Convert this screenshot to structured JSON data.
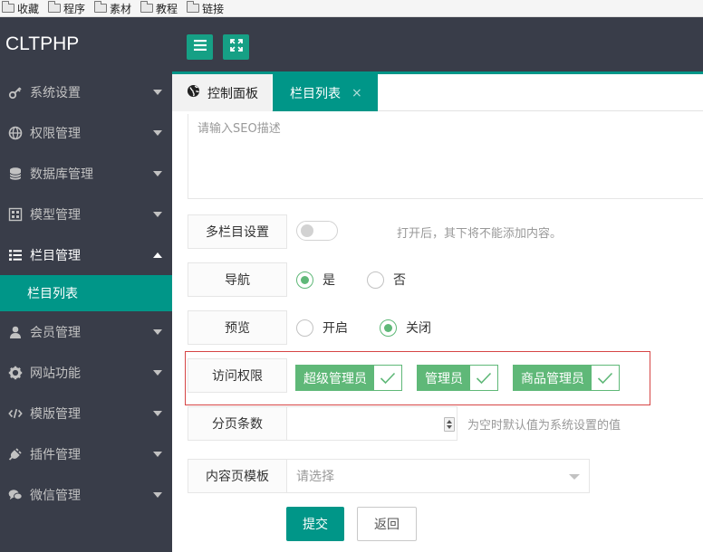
{
  "bookmarks": [
    {
      "label": "收藏"
    },
    {
      "label": "程序"
    },
    {
      "label": "素材"
    },
    {
      "label": "教程"
    },
    {
      "label": "链接"
    }
  ],
  "app": {
    "logo": "CLTPHP"
  },
  "sidebar": {
    "items": [
      {
        "label": "系统设置",
        "icon": "gear-key-icon"
      },
      {
        "label": "权限管理",
        "icon": "globe-icon"
      },
      {
        "label": "数据库管理",
        "icon": "database-icon"
      },
      {
        "label": "模型管理",
        "icon": "grid-icon"
      },
      {
        "label": "栏目管理",
        "icon": "list-icon"
      },
      {
        "label": "会员管理",
        "icon": "user-icon"
      },
      {
        "label": "网站功能",
        "icon": "gear-icon"
      },
      {
        "label": "模版管理",
        "icon": "code-icon"
      },
      {
        "label": "插件管理",
        "icon": "plug-icon"
      },
      {
        "label": "微信管理",
        "icon": "chat-icon"
      }
    ],
    "sub_item": "栏目列表"
  },
  "tabs": {
    "home": "控制面板",
    "active": "栏目列表",
    "close_glyph": "×"
  },
  "form": {
    "seo_placeholder": "请输入SEO描述",
    "multi": {
      "label": "多栏目设置",
      "hint": "打开后，其下将不能添加内容。"
    },
    "nav": {
      "label": "导航",
      "options": [
        "是",
        "否"
      ],
      "selected": "是"
    },
    "preview": {
      "label": "预览",
      "options": [
        "开启",
        "关闭"
      ],
      "selected": "关闭"
    },
    "access": {
      "label": "访问权限",
      "options": [
        "超级管理员",
        "管理员",
        "商品管理员"
      ]
    },
    "page_size": {
      "label": "分页条数",
      "value": "",
      "hint": "为空时默认值为系统设置的值"
    },
    "template": {
      "label": "内容页模板",
      "placeholder": "请选择"
    },
    "submit": "提交",
    "back": "返回"
  },
  "colors": {
    "primary": "#009688",
    "checked": "#5fb878",
    "sidebar": "#393d49",
    "highlight": "#d64545"
  }
}
